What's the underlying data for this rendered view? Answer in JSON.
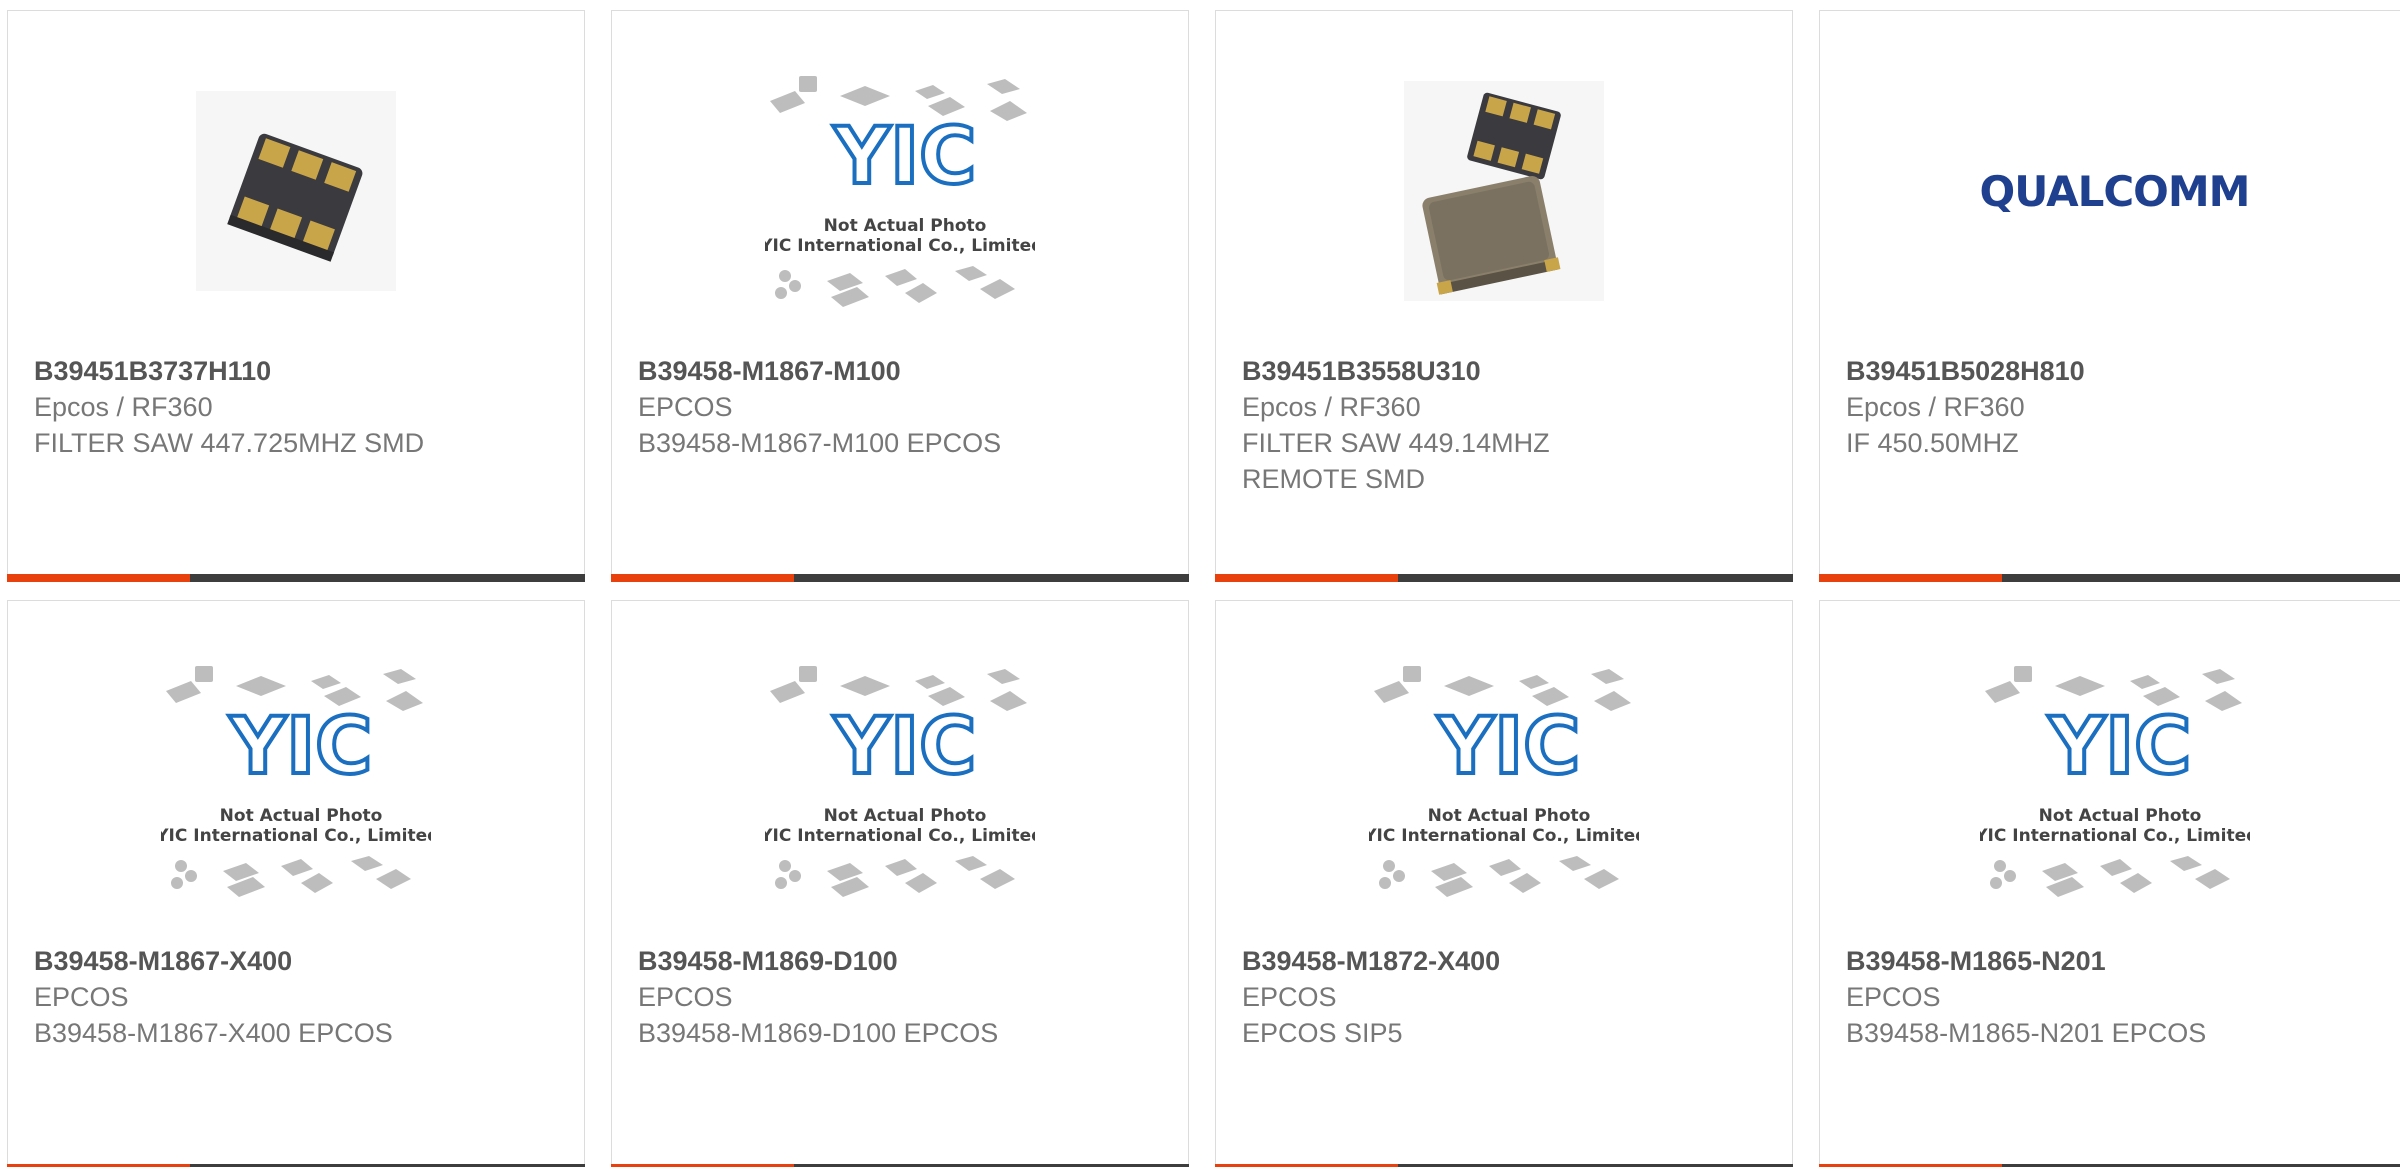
{
  "products": [
    {
      "part": "B39451B3737H110",
      "manufacturer": "Epcos / RF360",
      "description": [
        "FILTER SAW 447.725MHZ SMD"
      ],
      "image": "saw-filter-smd-photo"
    },
    {
      "part": "B39458-M1867-M100",
      "manufacturer": "EPCOS",
      "description": [
        "B39458-M1867-M100 EPCOS"
      ],
      "image": "yic-placeholder"
    },
    {
      "part": "B39451B3558U310",
      "manufacturer": "Epcos / RF360",
      "description": [
        "FILTER SAW 449.14MHZ",
        "REMOTE SMD"
      ],
      "image": "saw-filter-remote-photo"
    },
    {
      "part": "B39451B5028H810",
      "manufacturer": "Epcos / RF360",
      "description": [
        "IF 450.50MHZ"
      ],
      "image": "qualcomm-logo"
    },
    {
      "part": "B39458-M1867-X400",
      "manufacturer": "EPCOS",
      "description": [
        "B39458-M1867-X400 EPCOS"
      ],
      "image": "yic-placeholder"
    },
    {
      "part": "B39458-M1869-D100",
      "manufacturer": "EPCOS",
      "description": [
        "B39458-M1869-D100 EPCOS"
      ],
      "image": "yic-placeholder"
    },
    {
      "part": "B39458-M1872-X400",
      "manufacturer": "EPCOS",
      "description": [
        "EPCOS SIP5"
      ],
      "image": "yic-placeholder"
    },
    {
      "part": "B39458-M1865-N201",
      "manufacturer": "EPCOS",
      "description": [
        "B39458-M1865-N201 EPCOS"
      ],
      "image": "yic-placeholder"
    }
  ],
  "placeholder": {
    "line1": "Not Actual Photo",
    "line2": "YIC International Co., Limited.",
    "logo_text": "YIC"
  },
  "qualcomm": {
    "logo_text": "QUALCOMM"
  },
  "colors": {
    "accent": "#e8410e",
    "bar": "#3d3d3d",
    "logo_blue": "#1a6fc0",
    "qualcomm_blue": "#1f3f8f"
  }
}
